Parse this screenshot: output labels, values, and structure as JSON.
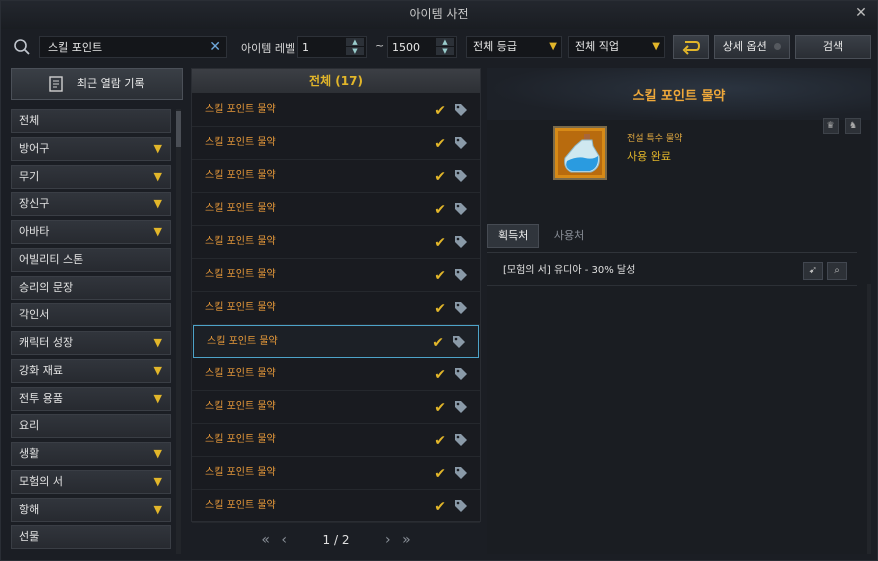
{
  "window": {
    "title": "아이템 사전"
  },
  "toolbar": {
    "search_value": "스킬 포인트",
    "level_label": "아이템 레벨",
    "level_min": "1",
    "level_max": "1500",
    "range_sep": "~",
    "grade_select": "전체 등급",
    "class_select": "전체 직업",
    "detail_options": "상세 옵션",
    "search_button": "검색"
  },
  "sidebar": {
    "recent_label": "최근 열람 기록",
    "categories": [
      {
        "label": "전체",
        "expandable": false
      },
      {
        "label": "방어구",
        "expandable": true
      },
      {
        "label": "무기",
        "expandable": true
      },
      {
        "label": "장신구",
        "expandable": true
      },
      {
        "label": "아바타",
        "expandable": true
      },
      {
        "label": "어빌리티 스톤",
        "expandable": false
      },
      {
        "label": "승리의 문장",
        "expandable": false
      },
      {
        "label": "각인서",
        "expandable": false
      },
      {
        "label": "캐릭터 성장",
        "expandable": true
      },
      {
        "label": "강화 재료",
        "expandable": true
      },
      {
        "label": "전투 용품",
        "expandable": true
      },
      {
        "label": "요리",
        "expandable": false
      },
      {
        "label": "생활",
        "expandable": true
      },
      {
        "label": "모험의 서",
        "expandable": true
      },
      {
        "label": "항해",
        "expandable": true
      },
      {
        "label": "선물",
        "expandable": false
      }
    ]
  },
  "list": {
    "header": "전체 (17)",
    "items": [
      "스킬 포인트 물약",
      "스킬 포인트 물약",
      "스킬 포인트 물약",
      "스킬 포인트 물약",
      "스킬 포인트 물약",
      "스킬 포인트 물약",
      "스킬 포인트 물약",
      "스킬 포인트 물약",
      "스킬 포인트 물약",
      "스킬 포인트 물약",
      "스킬 포인트 물약",
      "스킬 포인트 물약",
      "스킬 포인트 물약"
    ],
    "selected_index": 7,
    "page": "1 / 2"
  },
  "detail": {
    "name": "스킬 포인트 물약",
    "grade": "전설 특수 물약",
    "status": "사용 완료",
    "tabs": [
      "획득처",
      "사용처"
    ],
    "active_tab": 0,
    "source": "[모험의 서] 유디아 - 30% 달성"
  },
  "colors": {
    "accent": "#e2b62a",
    "item_text": "#e89a3a",
    "selected_border": "#4da3c9"
  }
}
